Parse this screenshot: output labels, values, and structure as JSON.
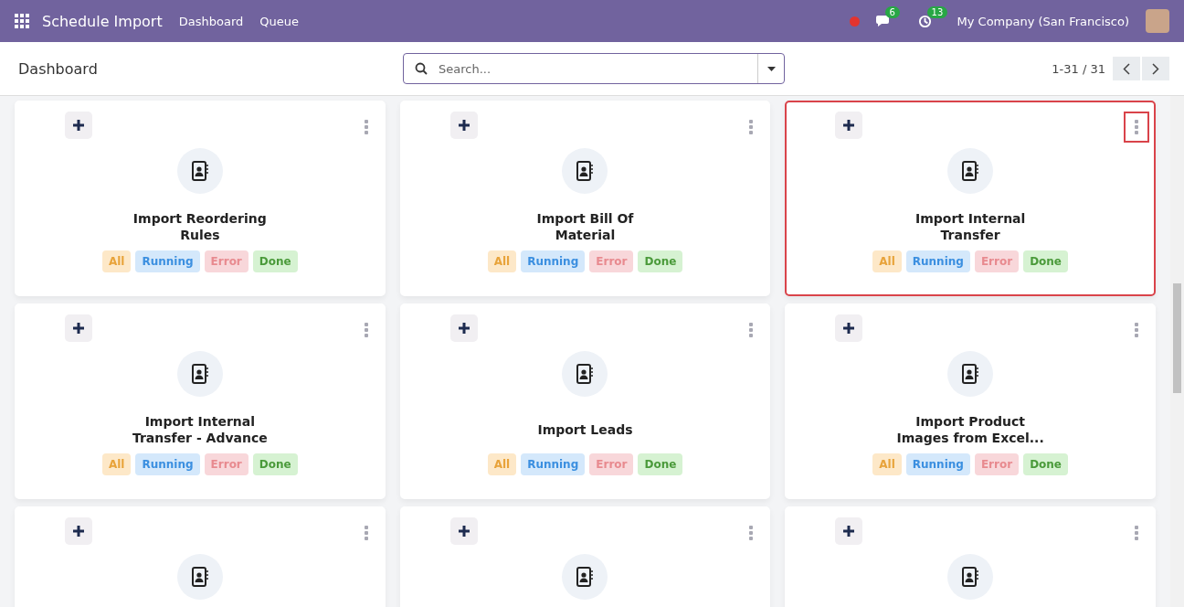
{
  "navbar": {
    "app_title": "Schedule Import",
    "menu": [
      "Dashboard",
      "Queue"
    ],
    "messages_count": "6",
    "activities_count": "13",
    "company": "My Company (San Francisco)"
  },
  "control_panel": {
    "breadcrumb": "Dashboard",
    "search": {
      "placeholder": "Search..."
    },
    "pager": "1-31 / 31"
  },
  "cards": [
    {
      "title": "Import Reordering Rules",
      "highlighted": false,
      "menu_highlighted": false,
      "tags": [
        {
          "kind": "all",
          "label": "All"
        },
        {
          "kind": "running",
          "label": "Running"
        },
        {
          "kind": "error",
          "label": "Error"
        },
        {
          "kind": "done",
          "label": "Done"
        }
      ]
    },
    {
      "title": "Import Bill Of Material",
      "highlighted": false,
      "menu_highlighted": false,
      "tags": [
        {
          "kind": "all",
          "label": "All"
        },
        {
          "kind": "running",
          "label": "Running"
        },
        {
          "kind": "error",
          "label": "Error"
        },
        {
          "kind": "done",
          "label": "Done"
        }
      ]
    },
    {
      "title": "Import Internal Transfer",
      "highlighted": true,
      "menu_highlighted": true,
      "tags": [
        {
          "kind": "all",
          "label": "All"
        },
        {
          "kind": "running",
          "label": "Running"
        },
        {
          "kind": "error",
          "label": "Error"
        },
        {
          "kind": "done",
          "label": "Done"
        }
      ]
    },
    {
      "title": "Import Internal Transfer - Advance",
      "highlighted": false,
      "menu_highlighted": false,
      "tags": [
        {
          "kind": "all",
          "label": "All"
        },
        {
          "kind": "running",
          "label": "Running"
        },
        {
          "kind": "error",
          "label": "Error"
        },
        {
          "kind": "done",
          "label": "Done"
        }
      ]
    },
    {
      "title": "Import Leads",
      "highlighted": false,
      "menu_highlighted": false,
      "tags": [
        {
          "kind": "all",
          "label": "All"
        },
        {
          "kind": "running",
          "label": "Running"
        },
        {
          "kind": "error",
          "label": "Error"
        },
        {
          "kind": "done",
          "label": "Done"
        }
      ]
    },
    {
      "title": "Import Product Images from Excel...",
      "highlighted": false,
      "menu_highlighted": false,
      "tags": [
        {
          "kind": "all",
          "label": "All"
        },
        {
          "kind": "running",
          "label": "Running"
        },
        {
          "kind": "error",
          "label": "Error"
        },
        {
          "kind": "done",
          "label": "Done"
        }
      ]
    },
    {
      "highlighted": false,
      "menu_highlighted": false
    },
    {
      "highlighted": false,
      "menu_highlighted": false
    },
    {
      "highlighted": false,
      "menu_highlighted": false
    }
  ]
}
